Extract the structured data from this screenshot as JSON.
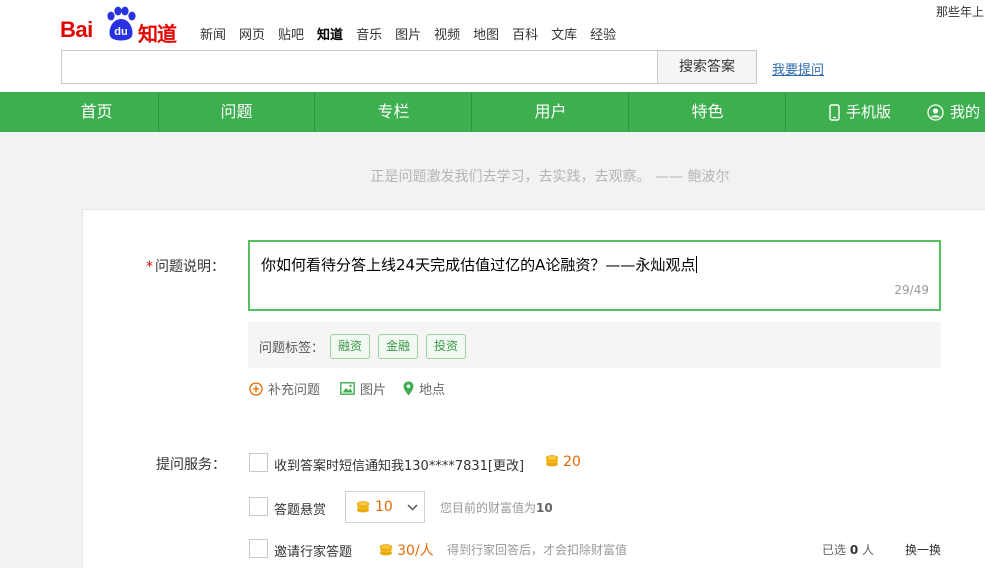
{
  "header": {
    "user_tip": "那些年上",
    "logo": {
      "bai": "Bai",
      "du": "du",
      "zhidao": "知道"
    },
    "nav": [
      "新闻",
      "网页",
      "贴吧",
      "知道",
      "音乐",
      "图片",
      "视频",
      "地图",
      "百科",
      "文库",
      "经验"
    ],
    "nav_active": "知道",
    "search": {
      "value": "",
      "placeholder": "",
      "button_label": "搜索答案"
    },
    "ask_link": "我要提问"
  },
  "greenbar": {
    "items": [
      "首页",
      "问题",
      "专栏",
      "用户",
      "特色"
    ],
    "phone_label": "手机版",
    "my_label": "我的"
  },
  "quote": "正是问题激发我们去学习，去实践，去观察。 —— 鲍波尔",
  "form": {
    "question_label": "问题说明：",
    "required_mark": "*",
    "question_text": "你如何看待分答上线24天完成估值过亿的A论融资？——永灿观点",
    "char_count": "29/49",
    "tags_label": "问题标签：",
    "tags": [
      "融资",
      "金融",
      "投资"
    ],
    "extras": [
      "补充问题",
      "图片",
      "地点"
    ],
    "service_label": "提问服务：",
    "sms_option": {
      "label": "收到答案时短信通知我130****7831[更改]",
      "cost": "20"
    },
    "reward_option": {
      "label": "答题悬赏",
      "selected_value": "10",
      "note_prefix": "您目前的财富值为",
      "wealth": "10"
    },
    "invite_option": {
      "label": "邀请行家答题",
      "cost": "30/人",
      "note": "得到行家回答后，才会扣除财富值",
      "selected_prefix": "已选",
      "selected_count": "0",
      "selected_suffix": "人",
      "refresh_label": "换一换"
    }
  },
  "colors": {
    "brand_red": "#e10602",
    "green": "#3eaf4f",
    "link_blue": "#2e6ab1",
    "coin_orange": "#e56a05"
  }
}
